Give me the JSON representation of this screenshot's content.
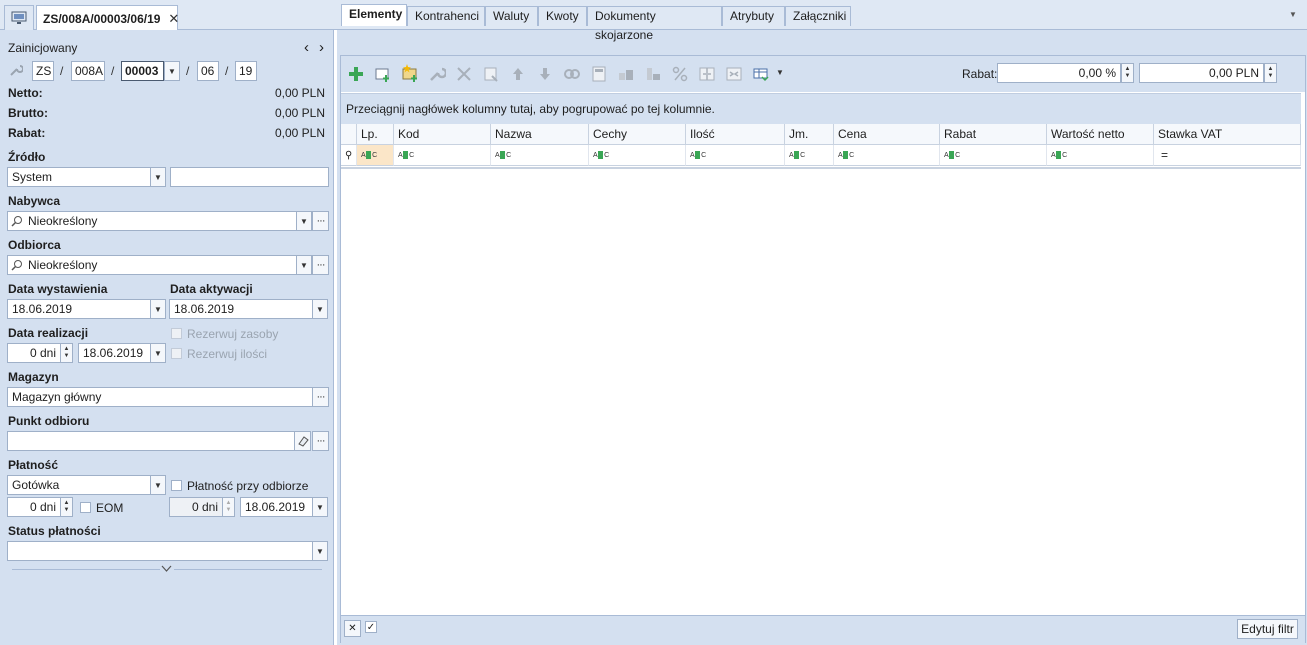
{
  "window": {
    "doc_tab_title": "ZS/008A/00003/06/19",
    "close_glyph": "✕",
    "menu_glyph": "▼"
  },
  "left": {
    "status": "Zainicjowany",
    "nav_prev": "‹",
    "nav_next": "›",
    "number": {
      "series": "ZS",
      "sep": "/",
      "symbol": "008A",
      "counter": "00003",
      "month": "06",
      "year": "19"
    },
    "netto": {
      "label": "Netto:",
      "value": "0,00 PLN"
    },
    "brutto": {
      "label": "Brutto:",
      "value": "0,00 PLN"
    },
    "rabat": {
      "label": "Rabat:",
      "value": "0,00 PLN"
    },
    "zrodlo": {
      "label": "Źródło",
      "value": "System",
      "extra": ""
    },
    "nabywca": {
      "label": "Nabywca",
      "value": "Nieokreślony"
    },
    "odbiorca": {
      "label": "Odbiorca",
      "value": "Nieokreślony"
    },
    "data_wystawienia": {
      "label": "Data wystawienia",
      "value": "18.06.2019"
    },
    "data_aktywacji": {
      "label": "Data aktywacji",
      "value": "18.06.2019"
    },
    "data_realizacji": {
      "label": "Data realizacji",
      "days": "0 dni",
      "value": "18.06.2019"
    },
    "rezerwuj_zasoby": "Rezerwuj zasoby",
    "rezerwuj_ilosci": "Rezerwuj ilości",
    "magazyn": {
      "label": "Magazyn",
      "value": "Magazyn główny"
    },
    "punkt_odbioru": {
      "label": "Punkt odbioru",
      "value": ""
    },
    "platnosc": {
      "label": "Płatność",
      "value": "Gotówka",
      "przy_odbiorze": "Płatność przy odbiorze",
      "days": "0 dni",
      "eom": "EOM",
      "days2": "0 dni",
      "date": "18.06.2019"
    },
    "status_platnosci": {
      "label": "Status płatności",
      "value": ""
    },
    "ellipsis": "···",
    "dd": "▼"
  },
  "tabs": [
    "Elementy",
    "Kontrahenci",
    "Waluty",
    "Kwoty",
    "Dokumenty skojarzone",
    "Atrybuty",
    "Załączniki"
  ],
  "toolbar": {
    "rabat_label": "Rabat:",
    "rabat_percent": "0,00 %",
    "rabat_amount": "0,00 PLN"
  },
  "grid": {
    "group_hint": "Przeciągnij nagłówek kolumny tutaj, aby pogrupować po tej kolumnie.",
    "columns": [
      "Lp.",
      "Kod",
      "Nazwa",
      "Cechy",
      "Ilość",
      "Jm.",
      "Cena",
      "Rabat",
      "Wartość netto",
      "Stawka VAT"
    ],
    "filter_pin": "⚲",
    "vat_filter": "="
  },
  "bottom": {
    "clear": "✕",
    "check": "✓",
    "edit_filter": "Edytuj filtr"
  },
  "colors": {
    "panel": "#d4e0f0",
    "border": "#a9bbd6",
    "add_green": "#3aa655"
  }
}
